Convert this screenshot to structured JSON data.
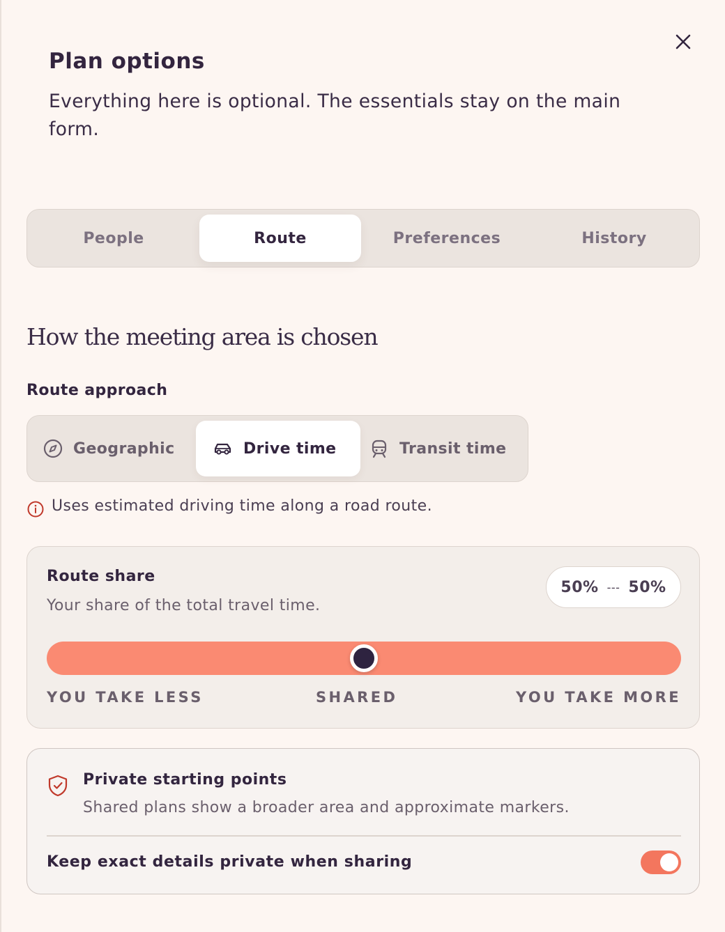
{
  "dialog": {
    "title": "Plan options",
    "subtitle": "Everything here is optional. The essentials stay on the main form."
  },
  "tabs": [
    {
      "label": "People",
      "active": false
    },
    {
      "label": "Route",
      "active": true
    },
    {
      "label": "Preferences",
      "active": false
    },
    {
      "label": "History",
      "active": false
    }
  ],
  "route": {
    "heading": "How the meeting area is chosen",
    "approach_label": "Route approach",
    "approaches": [
      {
        "label": "Geographic",
        "icon": "compass-icon",
        "active": false
      },
      {
        "label": "Drive time",
        "icon": "car-icon",
        "active": true
      },
      {
        "label": "Transit time",
        "icon": "train-icon",
        "active": false
      }
    ],
    "approach_info": "Uses estimated driving time along a road route."
  },
  "route_share": {
    "title": "Route share",
    "subtitle": "Your share of the total travel time.",
    "your_share": "50%",
    "separator": "---",
    "other_share": "50%",
    "slider_value": 0.5,
    "scale_labels": [
      "YOU TAKE LESS",
      "SHARED",
      "YOU TAKE MORE"
    ]
  },
  "privacy": {
    "title": "Private starting points",
    "subtitle": "Shared plans show a broader area and approximate markers.",
    "toggle_label": "Keep exact details private when sharing",
    "toggle_on": true
  },
  "colors": {
    "background": "#fdf6f2",
    "text": "#33253f",
    "accent": "#fa8a72",
    "toggle_on": "#f3765e",
    "info_icon": "#c0392b"
  }
}
